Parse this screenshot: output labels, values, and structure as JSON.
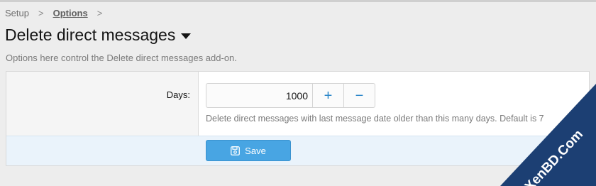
{
  "breadcrumb": {
    "items": [
      "Setup",
      "Options"
    ],
    "separator": ">"
  },
  "page": {
    "title": "Delete direct messages",
    "description": "Options here control the Delete direct messages add-on."
  },
  "option": {
    "label": "Days:",
    "value": "1000",
    "increment_symbol": "+",
    "decrement_symbol": "−",
    "explain": "Delete direct messages with last message date older than this many days. Default is 7"
  },
  "form": {
    "save_label": "Save"
  },
  "watermark": {
    "text": "XenBD.Com"
  },
  "colors": {
    "accent": "#48a5e3",
    "submit_bg": "#eaf3fb",
    "spin_icon": "#2a86c9"
  },
  "icons": {
    "title_dropdown": "caret-down-icon",
    "save": "floppy-disk-icon",
    "increment": "plus-icon",
    "decrement": "minus-icon",
    "breadcrumb_separator": "chevron-right-icon"
  }
}
